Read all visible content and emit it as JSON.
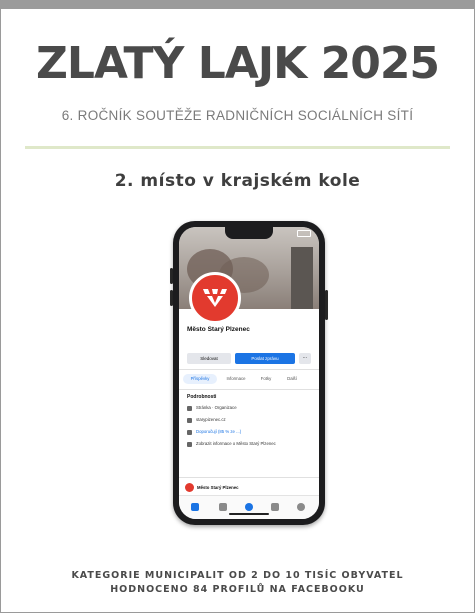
{
  "award": {
    "title": "ZLATÝ LAJK 2025",
    "subtitle": "6. ROČNÍK SOUTĚŽE RADNIČNÍCH SOCIÁLNÍCH SÍTÍ",
    "placement": "2. místo v krajském kole"
  },
  "phone_screen": {
    "page_name": "Město Starý Plzenec",
    "buttons": [
      "Sledovat",
      "Poslat zprávu"
    ],
    "tabs": [
      "Příspěvky",
      "Informace",
      "Fotky",
      "Další"
    ],
    "section_heading": "Podrobnosti",
    "info_items": [
      "Stránka · Organizace",
      "starypizenec.cz",
      "Doporučují (85 % ze ...)",
      "Zobrazit informace o Město Starý Plzenec"
    ],
    "post_author": "Město Starý Plzenec"
  },
  "footer": {
    "line1": "KATEGORIE MUNICIPALIT OD 2 DO 10 TISÍC OBYVATEL",
    "line2": "HODNOCENO 84 PROFILŮ NA FACEBOOKU"
  },
  "colors": {
    "title": "#4a4a4a",
    "divider": "#dfe8c9",
    "avatar_red": "#e23a2e",
    "facebook_blue": "#1b74e4"
  }
}
